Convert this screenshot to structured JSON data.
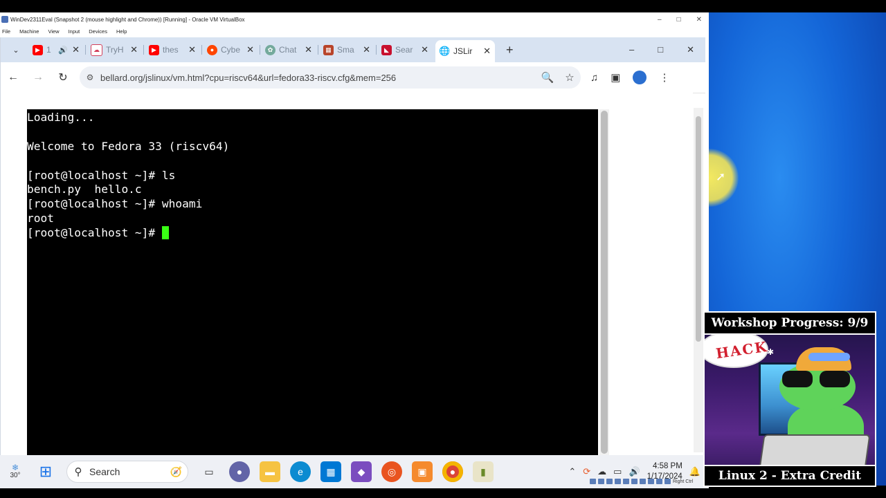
{
  "vm_window": {
    "title": "WinDev2311Eval (Snapshot 2 (mouse highlight and Chrome)) [Running] - Oracle VM VirtualBox",
    "menu": [
      "File",
      "Machine",
      "View",
      "Input",
      "Devices",
      "Help"
    ]
  },
  "browser": {
    "tabs": [
      {
        "title": "1",
        "favicon": "youtube-icon",
        "color": "#ff0000"
      },
      {
        "title": "TryH",
        "favicon": "tryhackme-icon",
        "color": "#d33f5a"
      },
      {
        "title": "thes",
        "favicon": "youtube-icon",
        "color": "#ff0000"
      },
      {
        "title": "Cybe",
        "favicon": "reddit-icon",
        "color": "#ff4500"
      },
      {
        "title": "Chat",
        "favicon": "chatgpt-icon",
        "color": "#74aa9c"
      },
      {
        "title": "Sma",
        "favicon": "site-icon",
        "color": "#b8442a"
      },
      {
        "title": "Sear",
        "favicon": "search-result-icon",
        "color": "#c8102e"
      },
      {
        "title": "JSLir",
        "favicon": "globe-icon",
        "color": "#555555"
      }
    ],
    "url": "bellard.org/jslinux/vm.html?cpu=riscv64&url=fedora33-riscv.cfg&mem=256"
  },
  "terminal": {
    "lines": [
      "Loading...",
      "",
      "Welcome to Fedora 33 (riscv64)",
      "",
      "[root@localhost ~]# ls",
      "bench.py  hello.c",
      "[root@localhost ~]# whoami",
      "root"
    ],
    "prompt": "[root@localhost ~]# ",
    "cursor_color": "#39ff14"
  },
  "taskbar": {
    "weather": "30°",
    "search_placeholder": "Search",
    "time": "4:58 PM",
    "date": "1/17/2024",
    "vbox_host_key": "Right Ctrl"
  },
  "overlay": {
    "header": "Workshop Progress: 9/9",
    "footer": "Linux 2 - Extra Credit",
    "cloud_text": "HACK"
  },
  "colors": {
    "desktop_accent": "#1466d8",
    "tabstrip": "#d8e3f2",
    "highlight": "#ffec50"
  }
}
